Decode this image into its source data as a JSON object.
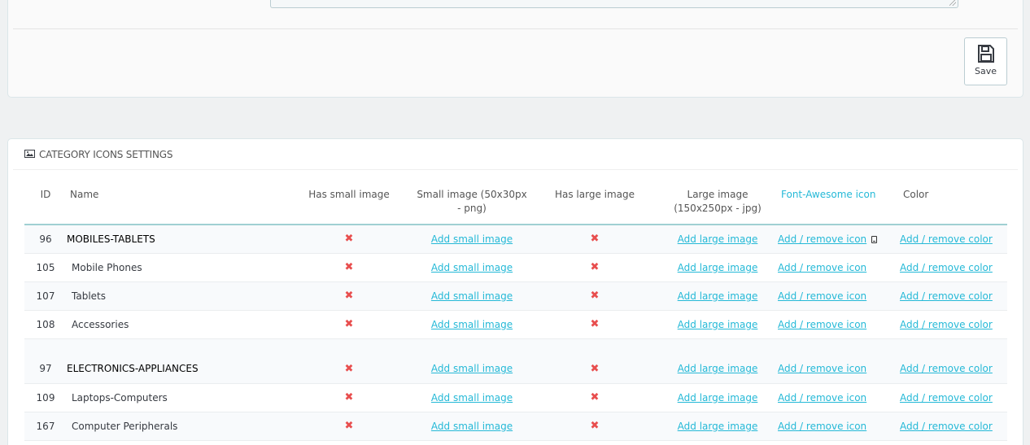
{
  "top": {
    "save_label": "Save"
  },
  "category_panel": {
    "heading": "CATEGORY ICONS SETTINGS",
    "columns": {
      "id": "ID",
      "name": "Name",
      "has_small": "Has small image",
      "small_image": "Small image (50x30px - png)",
      "has_large": "Has large image",
      "large_image": "Large image (150x250px - jpg)",
      "fa_icon": "Font-Awesome icon",
      "color": "Color"
    },
    "link_labels": {
      "add_small": "Add small image",
      "add_large": "Add large image",
      "add_icon": "Add / remove icon",
      "add_color": "Add / remove color"
    },
    "rows": [
      {
        "id": "96",
        "name": "MOBILES-TABLETS",
        "has_small": "✖",
        "has_large": "✖",
        "icon": "mobile-icon"
      },
      {
        "id": "105",
        "name": "Mobile Phones",
        "has_small": "✖",
        "has_large": "✖"
      },
      {
        "id": "107",
        "name": "Tablets",
        "has_small": "✖",
        "has_large": "✖"
      },
      {
        "id": "108",
        "name": "Accessories",
        "has_small": "✖",
        "has_large": "✖"
      },
      {
        "id": "97",
        "name": "ELECTRONICS-APPLIANCES",
        "has_small": "✖",
        "has_large": "✖"
      },
      {
        "id": "109",
        "name": "Laptops-Computers",
        "has_small": "✖",
        "has_large": "✖"
      },
      {
        "id": "167",
        "name": "Computer Peripherals",
        "has_small": "✖",
        "has_large": "✖"
      }
    ]
  },
  "colors": {
    "link": "#25b9d7",
    "cross": "#e84e4e",
    "header_border": "#a0d0d3"
  }
}
